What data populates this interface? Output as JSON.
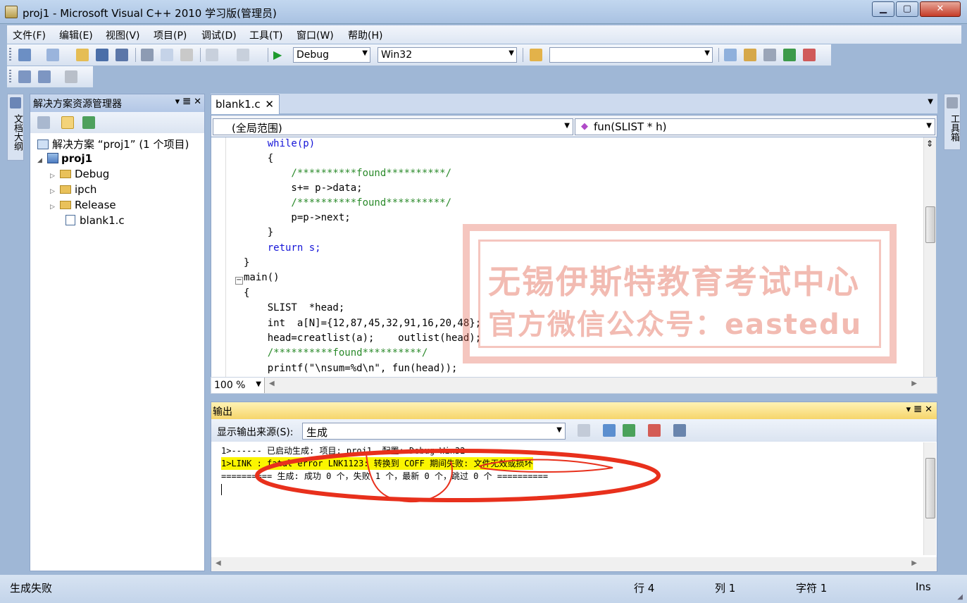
{
  "window": {
    "title": "proj1 - Microsoft Visual C++ 2010 学习版(管理员)",
    "min": "▁",
    "max": "▢",
    "close": "✕"
  },
  "menu": [
    "文件(F)",
    "编辑(E)",
    "视图(V)",
    "项目(P)",
    "调试(D)",
    "工具(T)",
    "窗口(W)",
    "帮助(H)"
  ],
  "toolbar": {
    "config": "Debug",
    "platform": "Win32",
    "find_value": ""
  },
  "side_tabs": {
    "left": "文档大纲",
    "right": "工具箱"
  },
  "solution_explorer": {
    "title": "解决方案资源管理器",
    "header_buttons": "▾ 𝌆 ✕",
    "tree": [
      {
        "label": "解决方案 “proj1” (1 个项目)",
        "kind": "solution"
      },
      {
        "label": "proj1",
        "kind": "project"
      },
      {
        "label": "Debug",
        "kind": "folder"
      },
      {
        "label": "ipch",
        "kind": "folder"
      },
      {
        "label": "Release",
        "kind": "folder"
      },
      {
        "label": "blank1.c",
        "kind": "file"
      }
    ]
  },
  "editor": {
    "tab": "blank1.c",
    "tab_close": "✕",
    "scope": "(全局范围)",
    "function": "fun(SLIST * h)",
    "zoom": "100 %",
    "code": [
      "    while(p)",
      "    {",
      "        /**********found**********/",
      "        s+= p->data;",
      "        /**********found**********/",
      "        p=p->next;",
      "    }",
      "    return s;",
      "}",
      "main()",
      "{",
      "    SLIST  *head;",
      "    int  a[N]={12,87,45,32,91,16,20,48};",
      "    head=creatlist(a);    outlist(head);",
      "    /**********found**********/",
      "    printf(\"\\nsum=%d\\n\", fun(head));"
    ]
  },
  "output": {
    "title": "输出",
    "source_label": "显示输出来源(S):",
    "source_value": "生成",
    "lines": [
      "1>------ 已启动生成: 项目: proj1, 配置: Debug Win32 ------",
      "1>LINK : fatal error LNK1123: 转换到 COFF 期间失败: 文件无效或损坏",
      "========== 生成: 成功 0 个，失败 1 个，最新 0 个，跳过 0 个 =========="
    ]
  },
  "status": {
    "message": "生成失败",
    "row": "行 4",
    "col": "列 1",
    "char": "字符 1",
    "mode": "Ins"
  },
  "watermark": {
    "line1": "无锡伊斯特教育考试中心",
    "line2": "官方微信公众号：eastedu"
  },
  "colors": {
    "keyword": "#1515d8",
    "comment": "#2a8a2a",
    "string": "#a31515",
    "highlight": "#fbf500",
    "annotation": "#e8301c"
  }
}
